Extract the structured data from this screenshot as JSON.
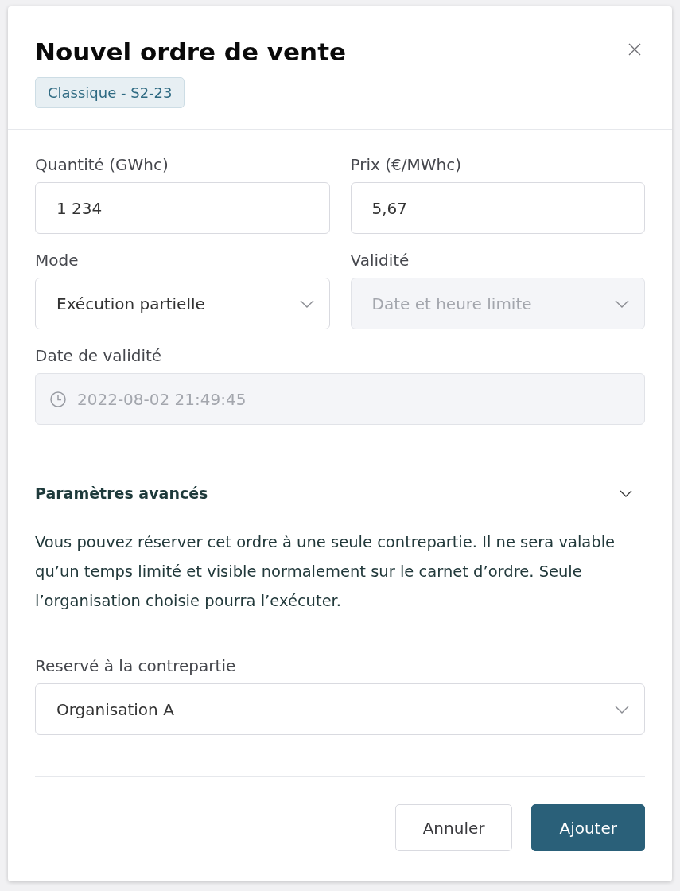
{
  "dialog": {
    "title": "Nouvel ordre de vente",
    "tag": "Classique - S2-23"
  },
  "form": {
    "rows": [
      [
        {
          "kind": "input",
          "label": "Quantité (GWhc)",
          "value": "1 234",
          "disabled": false
        },
        {
          "kind": "input",
          "label": "Prix (€/MWhc)",
          "value": "5,67",
          "disabled": false
        }
      ],
      [
        {
          "kind": "select",
          "label": "Mode",
          "value": "Exécution partielle",
          "disabled": false
        },
        {
          "kind": "select",
          "label": "Validité",
          "value": "Date et heure limite",
          "disabled": true
        }
      ],
      [
        {
          "kind": "datetime",
          "label": "Date de validité",
          "value": "2022-08-02 21:49:45",
          "disabled": true
        }
      ]
    ]
  },
  "advanced": {
    "title": "Paramètres avancés",
    "expanded": true,
    "description": "Vous pouvez réserver cet ordre à une seule contrepartie. Il ne sera valable qu’un temps limité et visible normalement sur le carnet d’ordre. Seule l’organisation choisie pourra l’exécuter.",
    "field": {
      "kind": "select",
      "label": "Reservé à la contrepartie",
      "value": "Organisation A",
      "disabled": false
    }
  },
  "buttons": [
    {
      "kind": "outline",
      "label": "Annuler"
    },
    {
      "kind": "primary",
      "label": "Ajouter"
    }
  ]
}
